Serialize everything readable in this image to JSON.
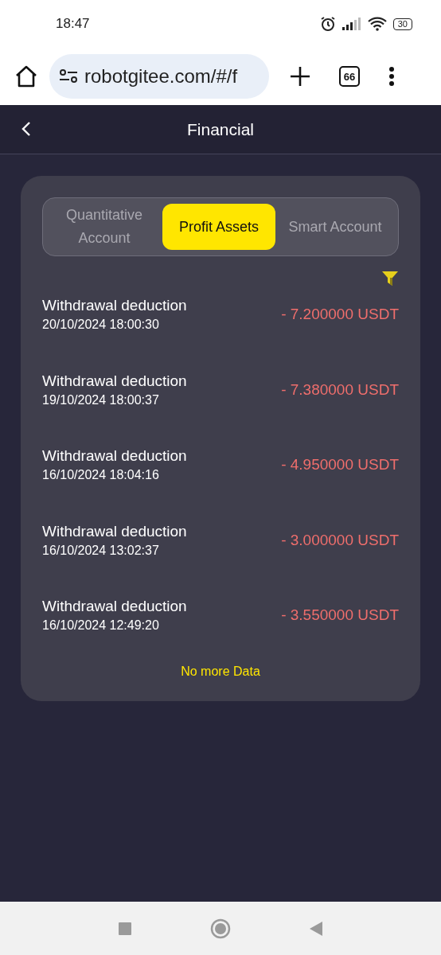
{
  "status_bar": {
    "time": "18:47",
    "battery": "30"
  },
  "browser": {
    "url": "robotgitee.com/#/f",
    "tab_count": "66"
  },
  "header": {
    "title": "Financial"
  },
  "tabs": [
    {
      "label": "Quantitative Account",
      "selected": false
    },
    {
      "label": "Profit Assets",
      "selected": true
    },
    {
      "label": "Smart Account",
      "selected": false
    }
  ],
  "records": [
    {
      "title": "Withdrawal deduction",
      "time": "20/10/2024 18:00:30",
      "amount": "- 7.200000 USDT"
    },
    {
      "title": "Withdrawal deduction",
      "time": "19/10/2024 18:00:37",
      "amount": "- 7.380000 USDT"
    },
    {
      "title": "Withdrawal deduction",
      "time": "16/10/2024 18:04:16",
      "amount": "- 4.950000 USDT"
    },
    {
      "title": "Withdrawal deduction",
      "time": "16/10/2024 13:02:37",
      "amount": "- 3.000000 USDT"
    },
    {
      "title": "Withdrawal deduction",
      "time": "16/10/2024 12:49:20",
      "amount": "- 3.550000 USDT"
    }
  ],
  "footer_note": "No more Data"
}
